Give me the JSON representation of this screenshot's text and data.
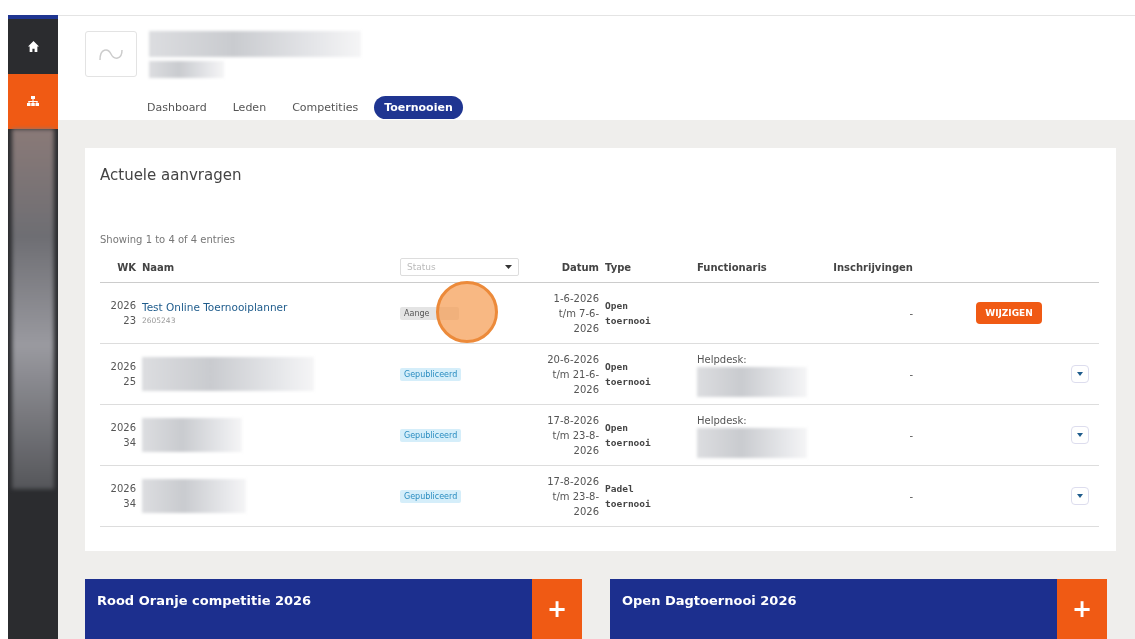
{
  "nav": {
    "tabs": [
      {
        "label": "Dashboard",
        "selected": false
      },
      {
        "label": "Leden",
        "selected": false
      },
      {
        "label": "Competities",
        "selected": false
      },
      {
        "label": "Toernooien",
        "selected": true
      }
    ]
  },
  "sidebar": {
    "items": [
      {
        "kind": "home",
        "selected": false
      },
      {
        "kind": "org",
        "selected": true
      }
    ]
  },
  "requests": {
    "title": "Actuele aanvragen",
    "info": "Showing 1 to 4 of 4 entries",
    "columns": {
      "wk": "WK",
      "naam": "Naam",
      "status_placeholder": "Status",
      "datum": "Datum",
      "type": "Type",
      "functionaris": "Functionaris",
      "inschrijvingen": "Inschrijvingen"
    },
    "rows": [
      {
        "year": "2026",
        "week": "23",
        "name": "Test Online Toernooiplanner",
        "code": "2605243",
        "status": "Aange",
        "kind": "requested",
        "date_lines": [
          "1-6-2026",
          "t/m 7-6-",
          "2026"
        ],
        "type_lines": [
          "Open",
          "toernooi"
        ],
        "official_label": "",
        "entries": "-",
        "action": {
          "kind": "button",
          "label": "WIJZIGEN"
        }
      },
      {
        "year": "2026",
        "week": "25",
        "status": "Gepubliceerd",
        "kind": "published",
        "date_lines": [
          "20-6-2026",
          "t/m 21-6-",
          "2026"
        ],
        "type_lines": [
          "Open",
          "toernooi"
        ],
        "official_label": "Helpdesk:",
        "entries": "-",
        "action": {
          "kind": "expand"
        }
      },
      {
        "year": "2026",
        "week": "34",
        "status": "Gepubliceerd",
        "kind": "published",
        "date_lines": [
          "17-8-2026",
          "t/m 23-8-",
          "2026"
        ],
        "type_lines": [
          "Open",
          "toernooi"
        ],
        "official_label": "Helpdesk:",
        "entries": "-",
        "action": {
          "kind": "expand"
        }
      },
      {
        "year": "2026",
        "week": "34",
        "status": "Gepubliceerd",
        "kind": "published",
        "date_lines": [
          "17-8-2026",
          "t/m 23-8-",
          "2026"
        ],
        "type_lines": [
          "Padel",
          "toernooi"
        ],
        "official_label": "",
        "entries": "-",
        "action": {
          "kind": "expand"
        }
      }
    ]
  },
  "cards": [
    {
      "title": "Rood Oranje competitie 2026",
      "button": "+"
    },
    {
      "title": "Open Dagtoernooi 2026",
      "button": "+"
    }
  ]
}
